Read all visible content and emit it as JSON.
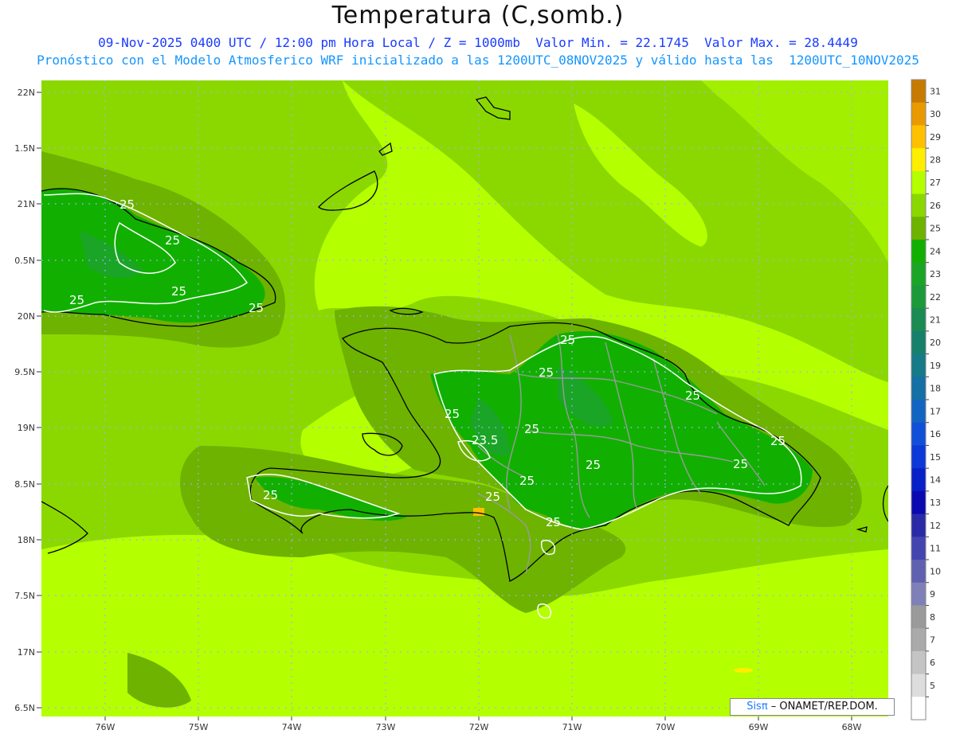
{
  "title": "Temperatura (C,somb.)",
  "subtitle_1": "09-Nov-2025 0400 UTC / 12:00 pm Hora Local / Z = 1000mb  Valor Min. = 22.1745  Valor Max. = 28.4449",
  "subtitle_2": "Pronóstico con el Modelo Atmosferico WRF inicializado a las 1200UTC_08NOV2025 y válido hasta las  1200UTC_10NOV2025",
  "credit": {
    "logo": "Sisπ",
    "text": " – ONAMET/REP.DOM."
  },
  "lat_labels": [
    "22N",
    "1.5N",
    "21N",
    "0.5N",
    "20N",
    "9.5N",
    "19N",
    "8.5N",
    "18N",
    "7.5N",
    "17N",
    "6.5N"
  ],
  "lon_labels": [
    "76W",
    "75W",
    "74W",
    "73W",
    "72W",
    "71W",
    "70W",
    "69W",
    "68W"
  ],
  "contour_labels": [
    "25",
    "25",
    "25",
    "25",
    "25",
    "25",
    "25",
    "25",
    "25",
    "23.5",
    "25",
    "25",
    "25",
    "25",
    "25",
    "25",
    "25",
    "25",
    "25"
  ],
  "colorbar": {
    "labels": [
      "31",
      "30",
      "29",
      "28",
      "27",
      "26",
      "25",
      "24",
      "23",
      "22",
      "21",
      "20",
      "19",
      "18",
      "17",
      "16",
      "15",
      "14",
      "13",
      "12",
      "11",
      "10",
      "9",
      "8",
      "7",
      "6",
      "5"
    ],
    "colors": [
      "#c77a00",
      "#e89a00",
      "#ffc000",
      "#ffee00",
      "#b4ff00",
      "#8bd800",
      "#6db300",
      "#11b000",
      "#1aa526",
      "#1c9a3a",
      "#1a8b52",
      "#16806a",
      "#167a88",
      "#1470a5",
      "#1264c2",
      "#1050d8",
      "#0c38d8",
      "#0820c8",
      "#0a0ab0",
      "#2a2aa8",
      "#4444b0",
      "#6060b0",
      "#8080b8",
      "#9a9a9a",
      "#aaaaaa",
      "#c4c4c4",
      "#dddddd",
      "#ffffff"
    ]
  },
  "field": {
    "min": "22.1745",
    "max": "28.4449",
    "units": "C"
  }
}
